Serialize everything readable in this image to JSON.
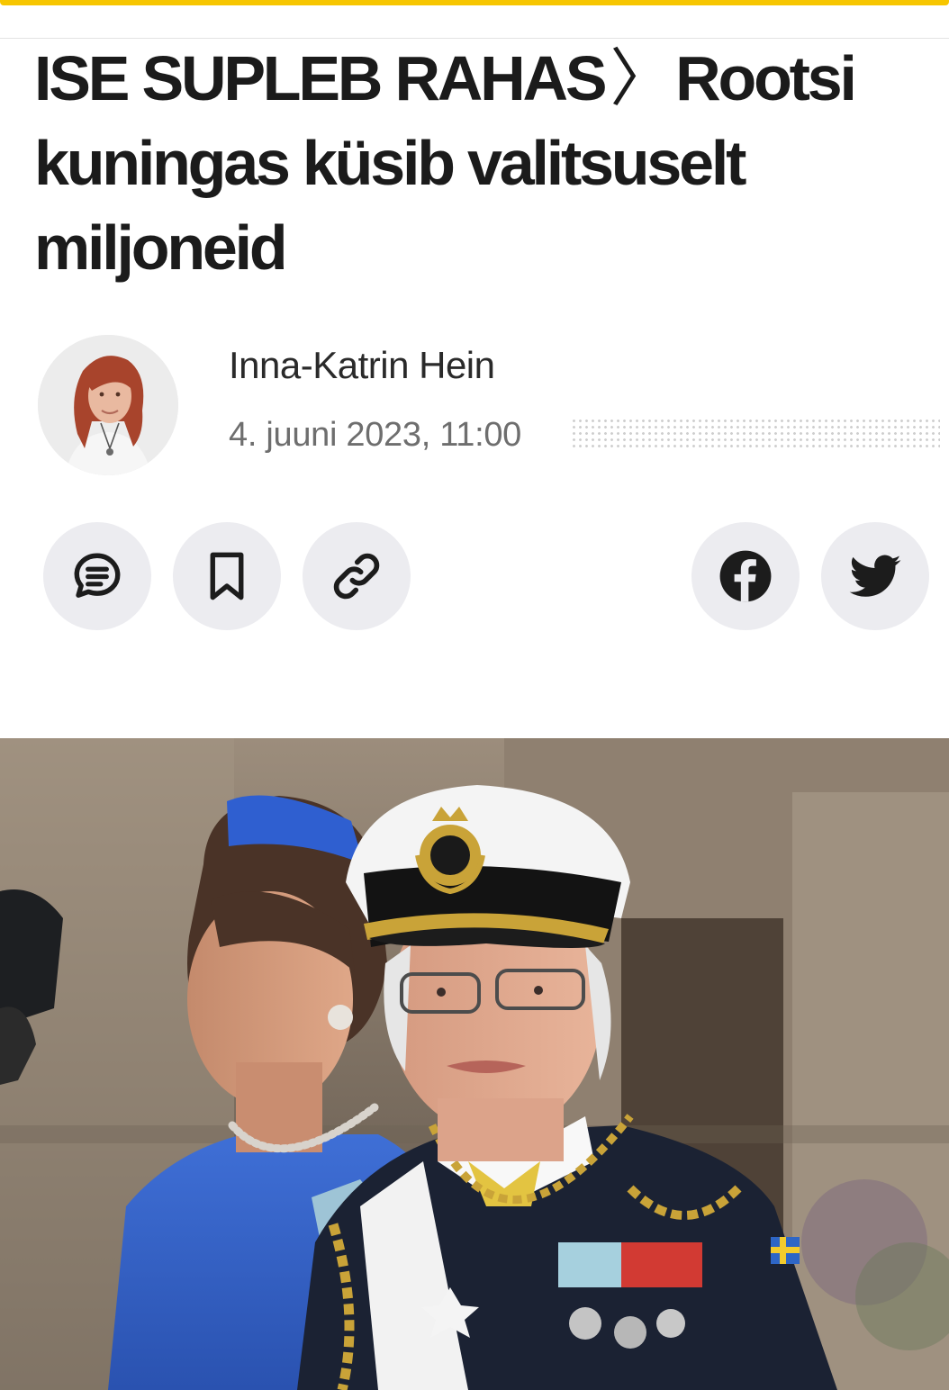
{
  "article": {
    "kicker": "ISE SUPLEB RAHAS",
    "separator": "〉",
    "title": "Rootsi kuningas küsib valitsuselt miljoneid"
  },
  "author": {
    "name": "Inna-Katrin Hein",
    "date": "4. juuni 2023, 11:00"
  },
  "actions": {
    "left": [
      {
        "name": "comments",
        "icon": "comment-icon"
      },
      {
        "name": "bookmark",
        "icon": "bookmark-icon"
      },
      {
        "name": "copy-link",
        "icon": "link-icon"
      }
    ],
    "right": [
      {
        "name": "facebook",
        "icon": "facebook-icon"
      },
      {
        "name": "twitter",
        "icon": "twitter-icon"
      }
    ]
  },
  "colors": {
    "accent": "#f7c600",
    "button_bg": "#ececf0",
    "icon": "#1c1c1c"
  }
}
